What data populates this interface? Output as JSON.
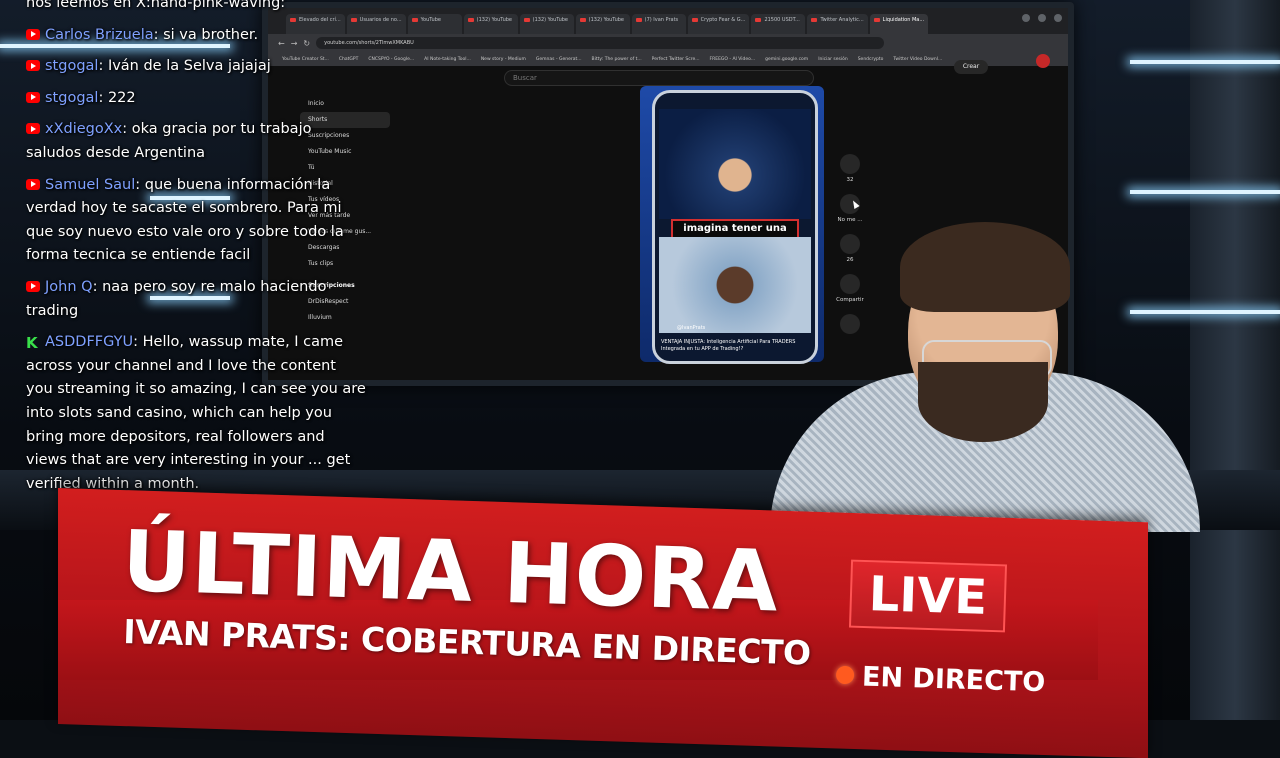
{
  "chat": {
    "top_partial": "nos leemos en X:hand-pink-waving:",
    "messages": [
      {
        "source": "youtube",
        "user": "Carlos Brizuela",
        "text": "si va brother."
      },
      {
        "source": "youtube",
        "user": "stgogal",
        "text": "Iván de la Selva jajajaj"
      },
      {
        "source": "youtube",
        "user": "stgogal",
        "text": "222"
      },
      {
        "source": "youtube",
        "user": "xXdiegoXx",
        "text": "oka gracia por tu trabajo saludos desde Argentina"
      },
      {
        "source": "youtube",
        "user": "Samuel Saul",
        "text": "que buena información la verdad hoy te sacaste el sombrero. Para mi que soy nuevo esto vale oro y sobre todo la forma tecnica se entiende facil"
      },
      {
        "source": "youtube",
        "user": "John Q",
        "text": "naa pero soy re malo haciendo trading"
      },
      {
        "source": "kick",
        "user": "ASDDFFGYU",
        "text": "Hello, wassup mate, I came across your channel and I love the content you streaming it so amazing, I can see you are into slots sand casino, which can help you bring more depositors, real followers and views that are very interesting in your ... get verified within a month."
      }
    ]
  },
  "browser": {
    "tabs": [
      "Elevado del crí...",
      "Usuarios de no...",
      "YouTube",
      "(132) YouTube",
      "(132) YouTube",
      "(132) YouTube",
      "(7) Ivan Prats",
      "Crypto Fear & G...",
      "21500 USDT...",
      "Twitter Analytic...",
      "Liquidation Ma..."
    ],
    "url": "youtube.com/shorts/2TlmwXMKABU",
    "bookmarks": [
      "YouTube Creator St...",
      "ChatGPT",
      "CNCSPYO - Google...",
      "AI Note-taking Tool...",
      "New story - Medium",
      "Gemnas - Generat...",
      "Bitty: The power of t...",
      "Perfect Twitter Scre...",
      "FREEGO - AI Video...",
      "gemini.google.com",
      "Iniciar sesión",
      "Sendcrypto",
      "Twitter Video Downl..."
    ]
  },
  "youtube": {
    "search_placeholder": "Buscar",
    "create_label": "Crear",
    "sidebar": [
      "Inicio",
      "Shorts",
      "Suscripciones",
      "YouTube Music",
      "Tú",
      "Historial",
      "Tus vídeos",
      "Ver más tarde",
      "Vídeos que me gus...",
      "Descargas",
      "Tus clips"
    ],
    "subs_heading": "Suscripciones",
    "subs": [
      "DrDisRespect",
      "Illuvium"
    ],
    "short": {
      "caption": "imagina tener una",
      "channel": "@IvanPrats",
      "title": "VENTAJA INJUSTA: Inteligencia Artificial Para TRADERS Integrada en tu APP de Trading!?"
    },
    "actions": [
      {
        "label": "32"
      },
      {
        "label": "No me ..."
      },
      {
        "label": "26"
      },
      {
        "label": "Compartir"
      },
      {
        "label": ""
      }
    ]
  },
  "lower_third": {
    "headline": "ÚLTIMA HORA",
    "subhead": "IVAN PRATS: COBERTURA EN DIRECTO",
    "live_label": "LIVE",
    "status_label": "EN DIRECTO"
  },
  "colors": {
    "banner_red": "#c4161b",
    "username_blue": "#7fa1ff",
    "youtube_red": "#ff0000",
    "kick_green": "#39e04a"
  }
}
